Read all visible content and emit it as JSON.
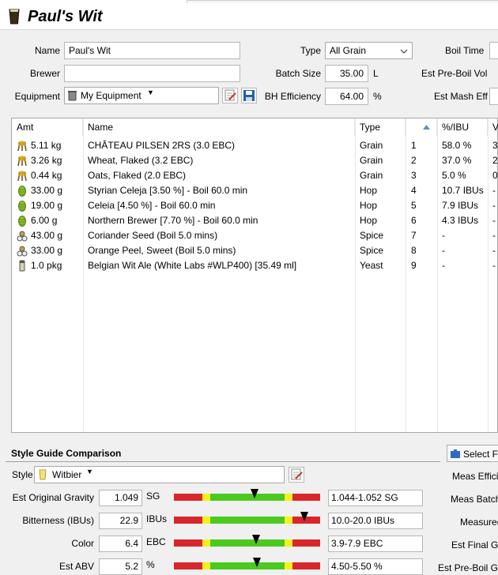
{
  "recipe": {
    "title": "Paul's Wit"
  },
  "form": {
    "name_label": "Name",
    "name_value": "Paul's Wit",
    "brewer_label": "Brewer",
    "brewer_value": "",
    "equipment_label": "Equipment",
    "equipment_value": "My Equipment",
    "type_label": "Type",
    "type_value": "All Grain",
    "batch_label": "Batch Size",
    "batch_value": "35.00",
    "batch_unit": "L",
    "eff_label": "BH Efficiency",
    "eff_value": "64.00",
    "eff_unit": "%",
    "boil_time_label": "Boil Time",
    "pre_boil_label": "Est Pre-Boil Vol",
    "mash_eff_label": "Est Mash Eff"
  },
  "table": {
    "headers": [
      "Amt",
      "Name",
      "Type",
      "",
      "%/IBU",
      "V"
    ],
    "rows": [
      {
        "icon": "grain",
        "amt": "5.11 kg",
        "name": "CHÂTEAU PILSEN 2RS (3.0 EBC)",
        "type": "Grain",
        "num": "1",
        "pct": "58.0 %",
        "extra": "3"
      },
      {
        "icon": "grain",
        "amt": "3.26 kg",
        "name": "Wheat, Flaked (3.2 EBC)",
        "type": "Grain",
        "num": "2",
        "pct": "37.0 %",
        "extra": "2"
      },
      {
        "icon": "grain",
        "amt": "0.44 kg",
        "name": "Oats, Flaked (2.0 EBC)",
        "type": "Grain",
        "num": "3",
        "pct": "5.0 %",
        "extra": "0"
      },
      {
        "icon": "hop",
        "amt": "33.00 g",
        "name": "Styrian Celeja [3.50 %] - Boil 60.0 min",
        "type": "Hop",
        "num": "4",
        "pct": "10.7 IBUs",
        "extra": "-"
      },
      {
        "icon": "hop",
        "amt": "19.00 g",
        "name": "Celeia [4.50 %] - Boil 60.0 min",
        "type": "Hop",
        "num": "5",
        "pct": "7.9 IBUs",
        "extra": "-"
      },
      {
        "icon": "hop",
        "amt": "6.00 g",
        "name": "Northern Brewer [7.70 %] - Boil 60.0 min",
        "type": "Hop",
        "num": "6",
        "pct": "4.3 IBUs",
        "extra": "-"
      },
      {
        "icon": "spice",
        "amt": "43.00 g",
        "name": "Coriander Seed (Boil 5.0 mins)",
        "type": "Spice",
        "num": "7",
        "pct": "-",
        "extra": "-"
      },
      {
        "icon": "spice",
        "amt": "33.00 g",
        "name": "Orange Peel, Sweet (Boil 5.0 mins)",
        "type": "Spice",
        "num": "8",
        "pct": "-",
        "extra": "-"
      },
      {
        "icon": "yeast",
        "amt": "1.0 pkg",
        "name": "Belgian Wit Ale (White Labs #WLP400) [35.49 ml]",
        "type": "Yeast",
        "num": "9",
        "pct": "-",
        "extra": "-"
      }
    ]
  },
  "style": {
    "section_title": "Style Guide Comparison",
    "style_label": "Style",
    "style_value": "Witbier",
    "select_button": "Select Fi",
    "metrics": [
      {
        "label": "Est Original Gravity",
        "value": "1.049",
        "unit": "SG",
        "range": "1.044-1.052 SG",
        "marker": 0.55
      },
      {
        "label": "Bitterness (IBUs)",
        "value": "22.9",
        "unit": "IBUs",
        "range": "10.0-20.0 IBUs",
        "marker": 0.89
      },
      {
        "label": "Color",
        "value": "6.4",
        "unit": "EBC",
        "range": "3.9-7.9 EBC",
        "marker": 0.56
      },
      {
        "label": "Est ABV",
        "value": "5.2",
        "unit": "%",
        "range": "4.50-5.50 %",
        "marker": 0.57
      }
    ],
    "right_labels": [
      "Meas Effici",
      "Meas Batch",
      "Measured",
      "Est Final Gr",
      "Est Pre-Boil Gr"
    ]
  },
  "colors": {
    "bar_red": "#d9262a",
    "bar_yellow": "#f4f11c",
    "bar_green": "#4cc91f"
  }
}
